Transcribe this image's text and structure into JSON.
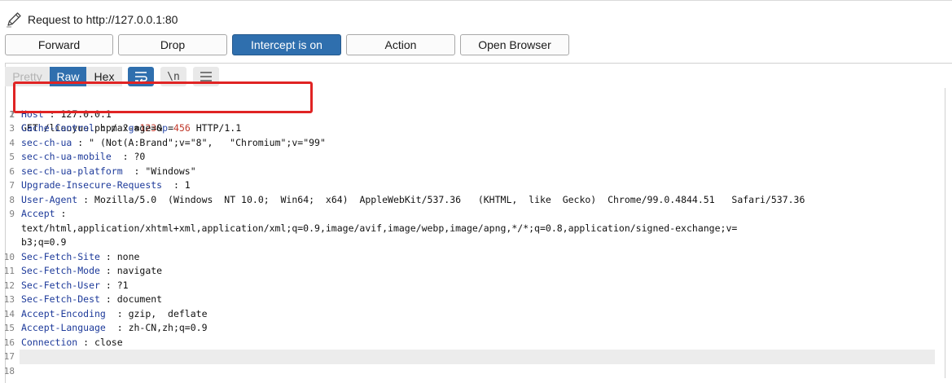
{
  "title": {
    "text": "Request to http://127.0.0.1:80",
    "icon": "pencil-icon"
  },
  "buttons": {
    "forward": "Forward",
    "drop": "Drop",
    "intercept": "Intercept is on",
    "action": "Action",
    "open_browser": "Open Browser"
  },
  "editor_tabs": {
    "pretty": "Pretty",
    "raw": "Raw",
    "hex": "Hex"
  },
  "editor_tools": {
    "newline": "\\n"
  },
  "colors": {
    "accent": "#2f6fae",
    "header_name": "#1d3a9a",
    "param_value": "#c0392b",
    "highlight_box": "#e02424"
  },
  "request": {
    "line1": {
      "prefix": "GET /liaoyue.php/ ?",
      "p1_name": "g",
      "eq1": "=",
      "p1_value": "123",
      "amp": "&",
      "p2_name": "p",
      "eq2": "=",
      "p2_value": "456",
      "suffix": " HTTP/1.1"
    },
    "headers": [
      {
        "name": "Host",
        "sep": " : ",
        "value": "127.0.0.1"
      },
      {
        "name": "Cache-Control",
        "sep": " : ",
        "value": "max-age=0"
      },
      {
        "name": "sec-ch-ua",
        "sep": " : ",
        "value": "\" (Not(A:Brand\";v=\"8\",   \"Chromium\";v=\"99\""
      },
      {
        "name": "sec-ch-ua-mobile",
        "sep": "  : ",
        "value": "?0"
      },
      {
        "name": "sec-ch-ua-platform",
        "sep": "  : ",
        "value": "\"Windows\""
      },
      {
        "name": "Upgrade-Insecure-Requests",
        "sep": "  : ",
        "value": "1"
      },
      {
        "name": "User-Agent",
        "sep": " : ",
        "value": "Mozilla/5.0  (Windows  NT 10.0;  Win64;  x64)  AppleWebKit/537.36   (KHTML,  like  Gecko)  Chrome/99.0.4844.51   Safari/537.36"
      },
      {
        "name": "Accept",
        "sep": " :",
        "value": ""
      },
      {
        "name": "Sec-Fetch-Site",
        "sep": " : ",
        "value": "none"
      },
      {
        "name": "Sec-Fetch-Mode",
        "sep": " : ",
        "value": "navigate"
      },
      {
        "name": "Sec-Fetch-User",
        "sep": " : ",
        "value": "?1"
      },
      {
        "name": "Sec-Fetch-Dest",
        "sep": " : ",
        "value": "document"
      },
      {
        "name": "Accept-Encoding",
        "sep": "  : ",
        "value": "gzip,  deflate"
      },
      {
        "name": "Accept-Language",
        "sep": "  : ",
        "value": "zh-CN,zh;q=0.9"
      },
      {
        "name": "Connection",
        "sep": " : ",
        "value": "close"
      }
    ],
    "accept_cont1": "text/html,application/xhtml+xml,application/xml;q=0.9,image/avif,image/webp,image/apng,*/*;q=0.8,application/signed-exchange;v=",
    "accept_cont2": "b3;q=0.9"
  },
  "line_numbers": [
    "1",
    "2",
    "3",
    "4",
    "5",
    "6",
    "7",
    "8",
    "9",
    "10",
    "11",
    "12",
    "13",
    "14",
    "15",
    "16",
    "17",
    "18"
  ]
}
